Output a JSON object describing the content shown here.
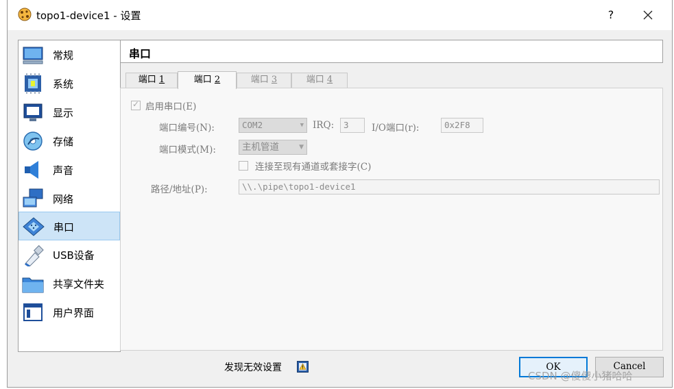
{
  "window": {
    "title": "topo1-device1 - 设置",
    "help_label": "?",
    "close_label": "×"
  },
  "sidebar": {
    "items": [
      {
        "label": "常规",
        "icon": "monitor-icon"
      },
      {
        "label": "系统",
        "icon": "chip-icon"
      },
      {
        "label": "显示",
        "icon": "display-icon"
      },
      {
        "label": "存储",
        "icon": "disk-icon"
      },
      {
        "label": "声音",
        "icon": "speaker-icon"
      },
      {
        "label": "网络",
        "icon": "network-icon"
      },
      {
        "label": "串口",
        "icon": "serial-port-icon"
      },
      {
        "label": "USB设备",
        "icon": "usb-icon"
      },
      {
        "label": "共享文件夹",
        "icon": "folder-icon"
      },
      {
        "label": "用户界面",
        "icon": "window-icon"
      }
    ],
    "selected": "串口"
  },
  "section": {
    "title": "串口"
  },
  "tabs": [
    {
      "label": "端口 ",
      "key": "1"
    },
    {
      "label": "端口 ",
      "key": "2"
    },
    {
      "label": "端口 ",
      "key": "3"
    },
    {
      "label": "端口 ",
      "key": "4"
    }
  ],
  "form": {
    "enable_label": "启用串口(E)",
    "port_number_label": "端口编号(N):",
    "port_number_value": "COM2",
    "irq_label": "IRQ:",
    "irq_value": "3",
    "io_port_label": "I/O端口(r):",
    "io_port_value": "0x2F8",
    "port_mode_label": "端口模式(M):",
    "port_mode_value": "主机管道",
    "connect_existing_label": "连接至现有通道或套接字(C)",
    "path_label": "路径/地址(P):",
    "path_value": "\\\\.\\pipe\\topo1-device1"
  },
  "footer": {
    "invalid_settings_label": "发现无效设置",
    "ok_label": "OK",
    "cancel_label": "Cancel"
  },
  "watermark": "CSDN @傻傻小猪哈哈",
  "colors": {
    "selection": "#cde4f7",
    "default_button_border": "#0078d7"
  }
}
